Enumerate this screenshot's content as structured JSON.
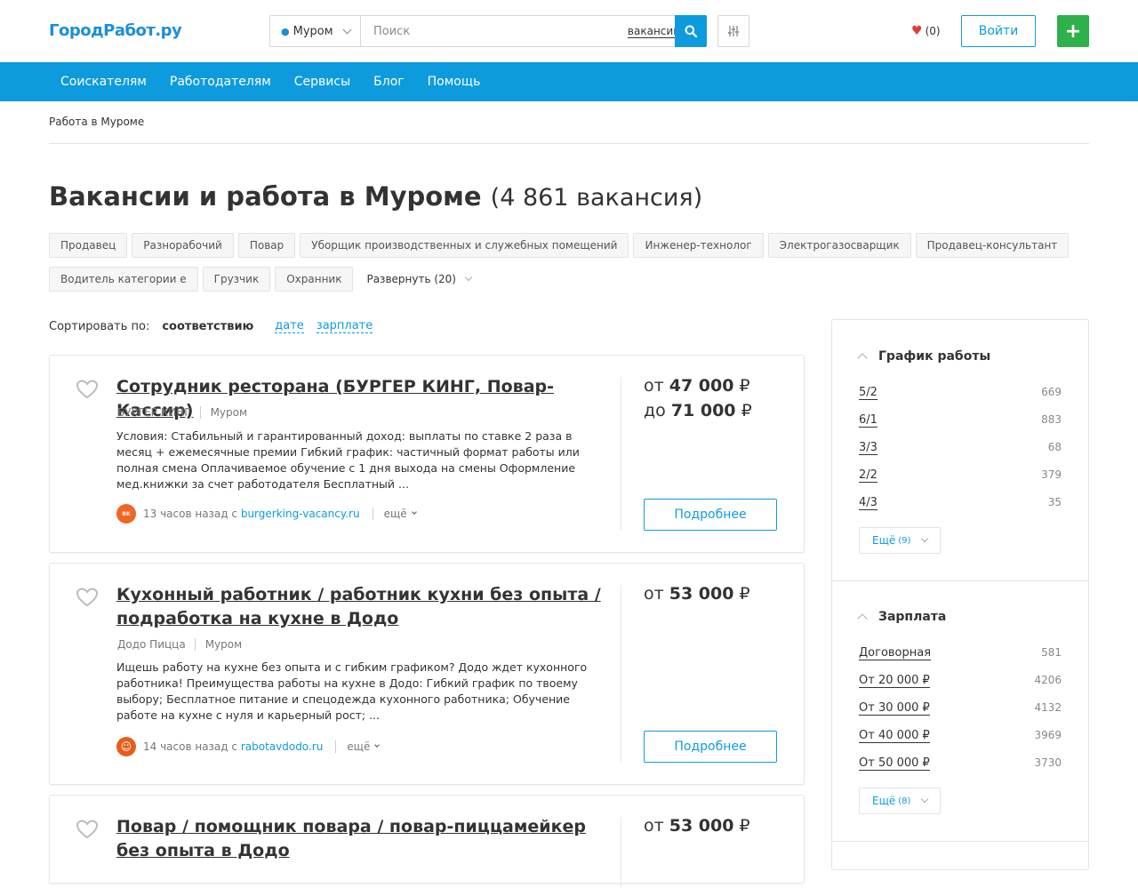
{
  "header": {
    "logo": "ГородРабот.ру",
    "city": "Муром",
    "search_placeholder": "Поиск",
    "search_type": "вакансии",
    "favorites_count": "(0)",
    "login": "Войти",
    "add": "+"
  },
  "nav": [
    "Соискателям",
    "Работодателям",
    "Сервисы",
    "Блог",
    "Помощь"
  ],
  "breadcrumb": "Работа в Муроме",
  "page": {
    "title": "Вакансии и работа в Муроме",
    "count": "(4 861 вакансия)"
  },
  "tags": {
    "row1": [
      "Продавец",
      "Разнорабочий",
      "Повар",
      "Уборщик производственных и служебных помещений",
      "Инженер-технолог",
      "Электрогазосварщик",
      "Продавец-консультант"
    ],
    "row2": [
      "Водитель категории е",
      "Грузчик",
      "Охранник"
    ],
    "expand": "Развернуть (20)"
  },
  "sort": {
    "label": "Сортировать по:",
    "active": "соответствию",
    "date": "дате",
    "salary": "зарплате"
  },
  "cards": [
    {
      "title": "Сотрудник ресторана (БУРГЕР КИНГ, Повар-Кассир)",
      "company": "БУРГЕР КИНГ",
      "city": "Муром",
      "desc": "Условия: Стабильный и гарантированный доход: выплаты по ставке 2 раза в месяц + ежемесячные премии Гибкий график: частичный формат работы или полная смена Оплачиваемое обучение с 1 дня выхода на смены Оформление мед.книжки за счет работодателя Бесплатный ...",
      "time": "13 часов назад с",
      "source": "burgerking-vacancy.ru",
      "more": "ещё",
      "salary_from_prefix": "от",
      "salary_from": "47 000",
      "salary_to_prefix": "до",
      "salary_to": "71 000",
      "currency": "₽",
      "button": "Подробнее",
      "logo_color": "#f26522",
      "logo_text": "BURGER KING"
    },
    {
      "title": "Кухонный работник / работник кухни без опыта / подработка на кухне в Додо",
      "company": "Додо Пицца",
      "city": "Муром",
      "desc": "Ищешь работу на кухне без опыта и с гибким графиком? Додо ждет кухонного работника! Преимущества работы на кухне в Додо: Гибкий график по твоему выбору; Бесплатное питание и спецодежда кухонного работника; Обучение работе на кухне с нуля и карьерный рост; ...",
      "time": "14 часов назад с",
      "source": "rabotavdodo.ru",
      "more": "ещё",
      "salary_from_prefix": "от",
      "salary_from": "53 000",
      "currency": "₽",
      "button": "Подробнее",
      "logo_color": "#e85d1a",
      "logo_text": "☺"
    },
    {
      "title": "Повар / помощник повара / повар-пиццамейкер без опыта в Додо",
      "salary_from_prefix": "от",
      "salary_from": "53 000",
      "currency": "₽"
    }
  ],
  "sidebar": {
    "schedule": {
      "title": "График работы",
      "items": [
        {
          "label": "5/2",
          "count": "669"
        },
        {
          "label": "6/1",
          "count": "883"
        },
        {
          "label": "3/3",
          "count": "68"
        },
        {
          "label": "2/2",
          "count": "379"
        },
        {
          "label": "4/3",
          "count": "35"
        }
      ],
      "more": "Ещё",
      "more_count": "(9)"
    },
    "salary": {
      "title": "Зарплата",
      "items": [
        {
          "label": "Договорная",
          "count": "581"
        },
        {
          "label": "От 20 000 ₽",
          "count": "4206"
        },
        {
          "label": "От 30 000 ₽",
          "count": "4132"
        },
        {
          "label": "От 40 000 ₽",
          "count": "3969"
        },
        {
          "label": "От 50 000 ₽",
          "count": "3730"
        }
      ],
      "more": "Ещё",
      "more_count": "(8)"
    }
  }
}
